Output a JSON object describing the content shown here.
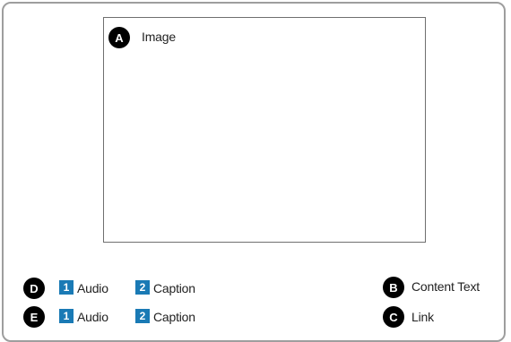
{
  "image_area": {
    "marker": "A",
    "label": "Image"
  },
  "legend_left": [
    {
      "marker": "D",
      "audio_num": "1",
      "audio_label": "Audio",
      "caption_num": "2",
      "caption_label": "Caption"
    },
    {
      "marker": "E",
      "audio_num": "1",
      "audio_label": "Audio",
      "caption_num": "2",
      "caption_label": "Caption"
    }
  ],
  "legend_right": [
    {
      "marker": "B",
      "label": "Content Text"
    },
    {
      "marker": "C",
      "label": "Link"
    }
  ],
  "colors": {
    "marker_bg": "#000000",
    "number_badge_bg": "#1a7ab5",
    "frame_border": "#9e9e9e"
  }
}
